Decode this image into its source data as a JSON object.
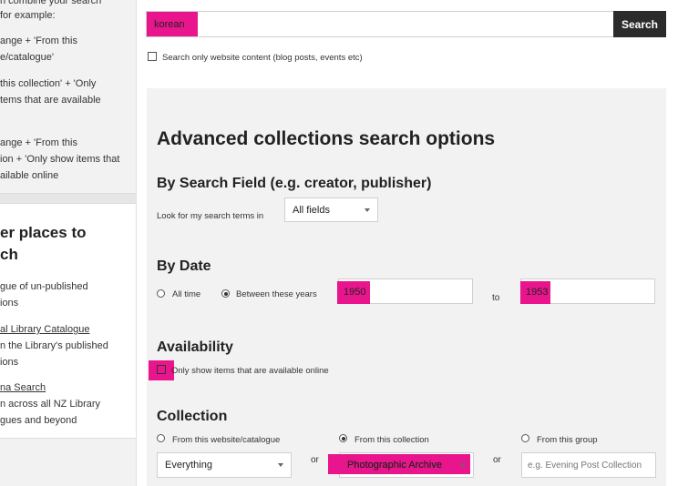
{
  "sidebar": {
    "tips": [
      "n combine your search",
      "for example:",
      "ange + 'From this",
      "e/catalogue'",
      "this collection' + 'Only",
      "tems that are available",
      "ange + 'From this",
      "ion + 'Only show items that",
      "ailable online"
    ],
    "other_places": {
      "heading_line1": "er places to",
      "heading_line2": "ch",
      "items": [
        {
          "lines": [
            "gue of un-published",
            "ions"
          ]
        },
        {
          "link": "al Library Catalogue",
          "lines": [
            "n the Library's published",
            "ions"
          ]
        },
        {
          "link": "na Search",
          "lines": [
            "n across all NZ Library",
            "gues and beyond"
          ]
        }
      ]
    }
  },
  "search": {
    "value": "korean",
    "button_label": "Search",
    "website_only_label": "Search only website content (blog posts, events etc)"
  },
  "advanced": {
    "title": "Advanced collections search options",
    "by_field": {
      "heading": "By Search Field (e.g. creator, publisher)",
      "label": "Look for my search terms in",
      "selected": "All fields"
    },
    "by_date": {
      "heading": "By Date",
      "all_time_label": "All time",
      "between_label": "Between these years",
      "from_value": "1950",
      "to_label": "to",
      "to_value": "1953"
    },
    "availability": {
      "heading": "Availability",
      "online_label": "Only show items that are available online"
    },
    "collection": {
      "heading": "Collection",
      "website_label": "From this website/catalogue",
      "collection_label": "From this collection",
      "group_label": "From this group",
      "website_selected": "Everything",
      "or_1": "or",
      "collection_selected": "Photographic Archive",
      "or_2": "or",
      "group_placeholder": "e.g. Evening Post Collection"
    }
  },
  "colors": {
    "highlight": "#e8158c",
    "button_bg": "#2b2b2b",
    "panel_bg": "#f2f2f2"
  }
}
